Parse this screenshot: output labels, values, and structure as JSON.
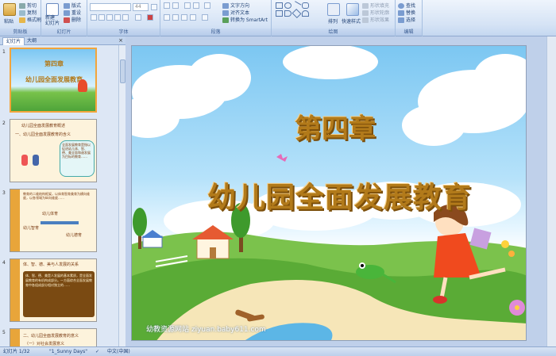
{
  "ribbon": {
    "clipboard": {
      "paste": "粘贴",
      "cut": "剪切",
      "copy": "复制",
      "format_painter": "格式刷",
      "group": "剪贴板"
    },
    "slides": {
      "new_slide": "新建\n幻灯片",
      "layout": "版式",
      "reset": "重设",
      "delete": "删除",
      "group": "幻灯片"
    },
    "font": {
      "size": "44",
      "group": "字体"
    },
    "paragraph": {
      "text_direction": "文字方向",
      "align_text": "对齐文本",
      "smartart": "转换为 SmartArt",
      "group": "段落"
    },
    "drawing": {
      "arrange": "排列",
      "quick_styles": "快速样式",
      "fill": "形状填充",
      "outline": "形状轮廓",
      "effects": "形状效果",
      "group": "绘图"
    },
    "editing": {
      "find": "查找",
      "replace": "替换",
      "select": "选择",
      "group": "编辑"
    }
  },
  "panel": {
    "tabs": [
      "幻灯片",
      "大纲"
    ],
    "close": "×",
    "slides": [
      {
        "num": "1",
        "title": "第四章",
        "subtitle": "幼儿园全面发展教育"
      },
      {
        "num": "2",
        "title": "幼儿园全面发展教育概述",
        "heading": "一、幼儿园全面发展教育的含义",
        "body": "全面发展教育是指以促进幼儿体、智、德、美全面和谐发展为目标的教育……"
      },
      {
        "num": "3",
        "body": "教育的二维结构框架，以体育智育美育为横向维度，以各领域为纵向维度……",
        "row1": "幼儿体育",
        "row2": "幼儿智育",
        "row3": "幼儿德育"
      },
      {
        "num": "4",
        "title": "体、智、德、美与人发展的关系",
        "body": "体、智、德、美是人发展的基本素质，是全面发展教育的有机构成部分。一方面综合全面发展教育中各组成部分相对独立的……"
      },
      {
        "num": "5",
        "title": "二、幼儿园全面发展教育的意义",
        "heading": "（一）对社会发展意义"
      }
    ]
  },
  "slide": {
    "title": "第四章",
    "subtitle": "幼儿园全面发展教育",
    "watermark": "幼教资源网站 ziyuan.baby611.com"
  },
  "status": {
    "slide_info": "幻灯片 1/32",
    "theme": "\"1_Sunny Days\"",
    "language": "中文(中国)"
  }
}
